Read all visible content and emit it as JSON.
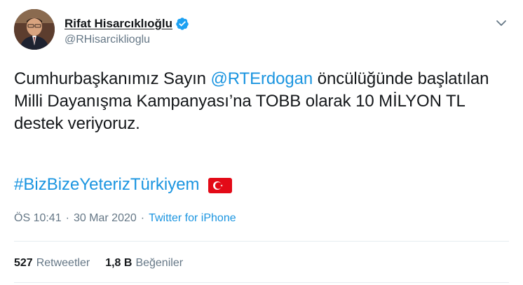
{
  "user": {
    "display_name": "Rifat Hisarcıklıoğlu",
    "handle": "@RHisarciklioglu",
    "verified": true,
    "avatar_icon": "user-avatar"
  },
  "tweet": {
    "text_part1": "Cumhurbaşkanımız Sayın ",
    "mention": "@RTErdogan",
    "text_part2": " öncülüğünde başlatılan Milli Dayanışma Kampanyası’na TOBB olarak 10 MİLYON TL destek veriyoruz.",
    "hashtag": "#BizBizeYeterizTürkiyem",
    "flag_icon": "turkey-flag-emoji"
  },
  "meta": {
    "time": "ÖS 10:41",
    "separator": "·",
    "date": "30 Mar 2020",
    "source": "Twitter for iPhone"
  },
  "stats": {
    "retweets_count": "527",
    "retweets_label": "Retweetler",
    "likes_count": "1,8 B",
    "likes_label": "Beğeniler"
  },
  "colors": {
    "link": "#1b95e0",
    "secondary_text": "#657786",
    "primary_text": "#14171a",
    "verified_badge": "#1da1f2",
    "divider": "#e6ecf0"
  },
  "icons": {
    "verified": "verified-badge-icon",
    "caret": "chevron-down-icon"
  }
}
